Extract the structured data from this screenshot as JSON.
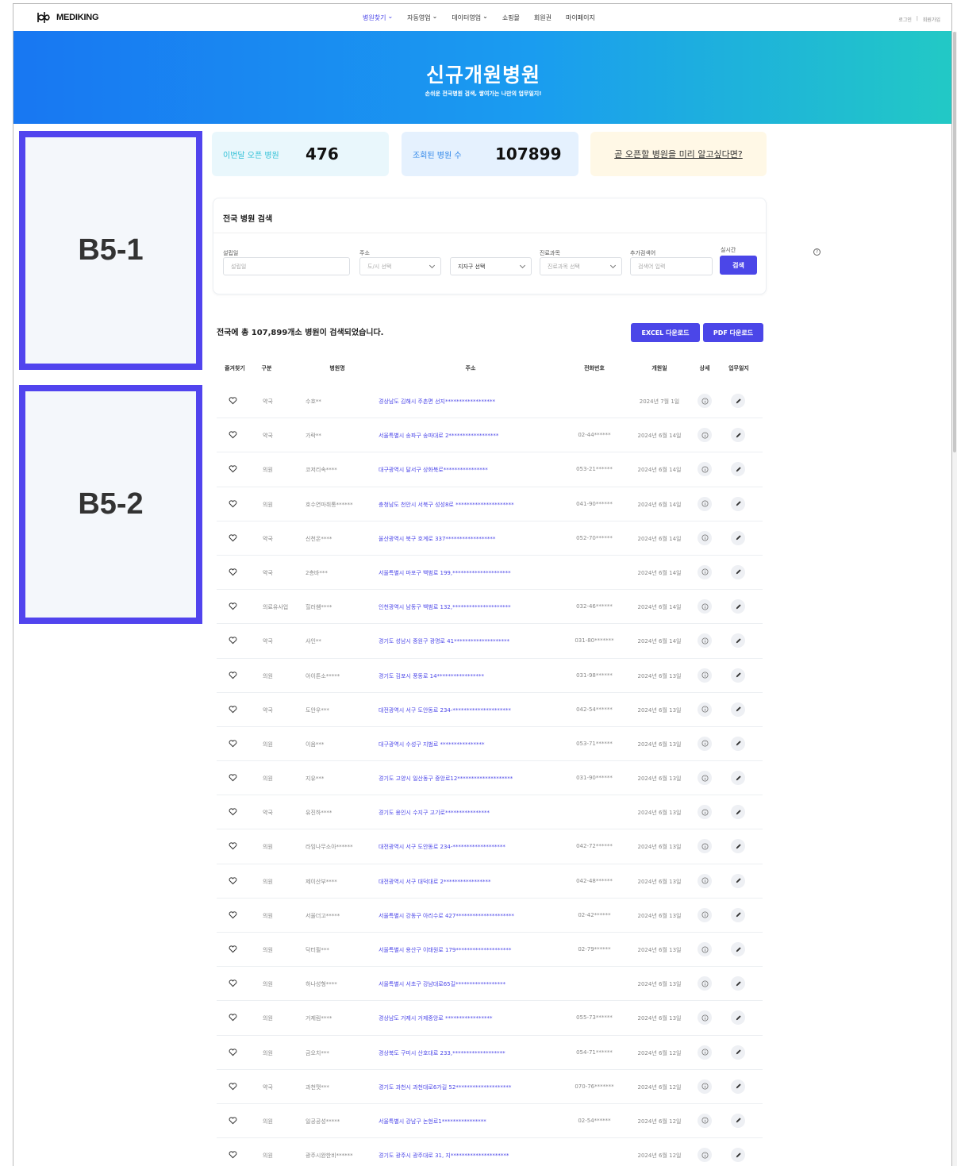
{
  "nav": {
    "logo_text": "MEDIKING",
    "menu": [
      {
        "label": "병원찾기",
        "has_dropdown": true,
        "active": true
      },
      {
        "label": "자동영업",
        "has_dropdown": true
      },
      {
        "label": "데이터영업",
        "has_dropdown": true
      },
      {
        "label": "쇼핑몰",
        "has_dropdown": false
      },
      {
        "label": "회원권",
        "has_dropdown": false
      },
      {
        "label": "마이페이지",
        "has_dropdown": false
      }
    ],
    "login": "로그인",
    "separator": "|",
    "signup": "회원가입"
  },
  "banner": {
    "title": "신규개원병원",
    "subtitle": "손쉬운 전국병원 검색, 쌓여가는 나만의 업무일지!"
  },
  "side_blocks": [
    "B5-1",
    "B5-2"
  ],
  "stats": {
    "month_open_label": "이번달 오픈 병원",
    "month_open_value": "476",
    "searched_label": "조회된 병원 수",
    "searched_value": "107899",
    "preview_link": "곧 오픈할 병원을 미리 알고싶다면?"
  },
  "search": {
    "title": "전국 병원 검색",
    "open_date_label": "설립일",
    "open_date_placeholder": "설립일",
    "address_label": "주소",
    "city_placeholder": "도/시 선택",
    "district_value": "지자구 선택",
    "dept_label": "진료과목",
    "dept_placeholder": "진료과목 선택",
    "help_icon": "?",
    "keyword_label": "추가검색어",
    "keyword_placeholder": "검색어 입력",
    "realtime_label": "실시간",
    "search_button": "검색"
  },
  "results": {
    "summary": "전국에 총 107,899개소 병원이 검색되었습니다.",
    "excel_button": "EXCEL 다운로드",
    "pdf_button": "PDF 다운로드",
    "columns": [
      "즐겨찾기",
      "구분",
      "병원명",
      "주소",
      "전화번호",
      "개원일",
      "상세",
      "업무일지"
    ],
    "rows": [
      {
        "cat": "약국",
        "name": "수호**",
        "addr": "경상남도 김해시 주촌면 선지******************",
        "tel": "",
        "date": "2024년 7월 1일"
      },
      {
        "cat": "약국",
        "name": "가락**",
        "addr": "서울특별시 송파구 송파대로 2******************",
        "tel": "02-44******",
        "date": "2024년 6월 14일"
      },
      {
        "cat": "의원",
        "name": "코저리속****",
        "addr": "대구광역시 달서구 상화북로****************",
        "tel": "053-21******",
        "date": "2024년 6월 14일"
      },
      {
        "cat": "의원",
        "name": "호수연마취통******",
        "addr": "충청남도 천안시 서북구 성성8로 *********************",
        "tel": "041-90******",
        "date": "2024년 6월 14일"
      },
      {
        "cat": "약국",
        "name": "신천온****",
        "addr": "울산광역시 북구 호계로 337******************",
        "tel": "052-70******",
        "date": "2024년 6월 14일"
      },
      {
        "cat": "약국",
        "name": "2층바***",
        "addr": "서울특별시 마포구 백범로 199,*********************",
        "tel": "",
        "date": "2024년 6월 14일"
      },
      {
        "cat": "의료유사업",
        "name": "힐러쌤****",
        "addr": "인천광역시 남동구 백범로 132,*********************",
        "tel": "032-46******",
        "date": "2024년 6월 14일"
      },
      {
        "cat": "약국",
        "name": "샤인**",
        "addr": "경기도 성남시 중원구 광명로 41********************",
        "tel": "031-80*******",
        "date": "2024년 6월 14일"
      },
      {
        "cat": "의원",
        "name": "아이튼소*****",
        "addr": "경기도 김포시 풍동로 14*****************",
        "tel": "031-98******",
        "date": "2024년 6월 13일"
      },
      {
        "cat": "약국",
        "name": "도안우***",
        "addr": "대전광역시 서구 도안동로 234-*********************",
        "tel": "042-54******",
        "date": "2024년 6월 13일"
      },
      {
        "cat": "의원",
        "name": "이음***",
        "addr": "대구광역시 수성구 지범로 ****************",
        "tel": "053-71******",
        "date": "2024년 6월 13일"
      },
      {
        "cat": "의원",
        "name": "지유***",
        "addr": "경기도 고양시 일산동구 중앙로12********************",
        "tel": "031-90******",
        "date": "2024년 6월 13일"
      },
      {
        "cat": "약국",
        "name": "유진하****",
        "addr": "경기도 용인시 수지구 고기로****************",
        "tel": "",
        "date": "2024년 6월 13일"
      },
      {
        "cat": "의원",
        "name": "라임나무소아******",
        "addr": "대전광역시 서구 도안동로 234-*******************",
        "tel": "042-72******",
        "date": "2024년 6월 13일"
      },
      {
        "cat": "의원",
        "name": "제이산부****",
        "addr": "대전광역시 서구 대덕대로 2*****************",
        "tel": "042-48******",
        "date": "2024년 6월 13일"
      },
      {
        "cat": "의원",
        "name": "서울더고*****",
        "addr": "서울특별시 강동구 아리수로 427*********************",
        "tel": "02-42******",
        "date": "2024년 6월 13일"
      },
      {
        "cat": "의원",
        "name": "닥터필***",
        "addr": "서울특별시 용산구 이태원로 179********************",
        "tel": "02-79******",
        "date": "2024년 6월 13일"
      },
      {
        "cat": "의원",
        "name": "하나성형****",
        "addr": "서울특별시 서초구 강남대로65길******************",
        "tel": "",
        "date": "2024년 6월 13일"
      },
      {
        "cat": "의원",
        "name": "거제림****",
        "addr": "경상남도 거제시 거제중앙로 *****************",
        "tel": "055-73******",
        "date": "2024년 6월 13일"
      },
      {
        "cat": "의원",
        "name": "금오치***",
        "addr": "경상북도 구미시 산호대로 233,*******************",
        "tel": "054-71******",
        "date": "2024년 6월 12일"
      },
      {
        "cat": "약국",
        "name": "과천맷***",
        "addr": "경기도 과천시 과천대로6가길 52********************",
        "tel": "070-76*******",
        "date": "2024년 6월 12일"
      },
      {
        "cat": "의원",
        "name": "일공공성*****",
        "addr": "서울특별시 강남구 논현로1****************",
        "tel": "02-54******",
        "date": "2024년 6월 12일"
      },
      {
        "cat": "의원",
        "name": "광주시완한비******",
        "addr": "경기도 광주시 광주대로 31, 지*********************",
        "tel": "",
        "date": "2024년 6월 12일"
      }
    ]
  },
  "colors": {
    "accent": "#4b46e8",
    "banner_start": "#1877f2",
    "banner_end": "#22c9c5",
    "block_border": "#5144ee"
  }
}
